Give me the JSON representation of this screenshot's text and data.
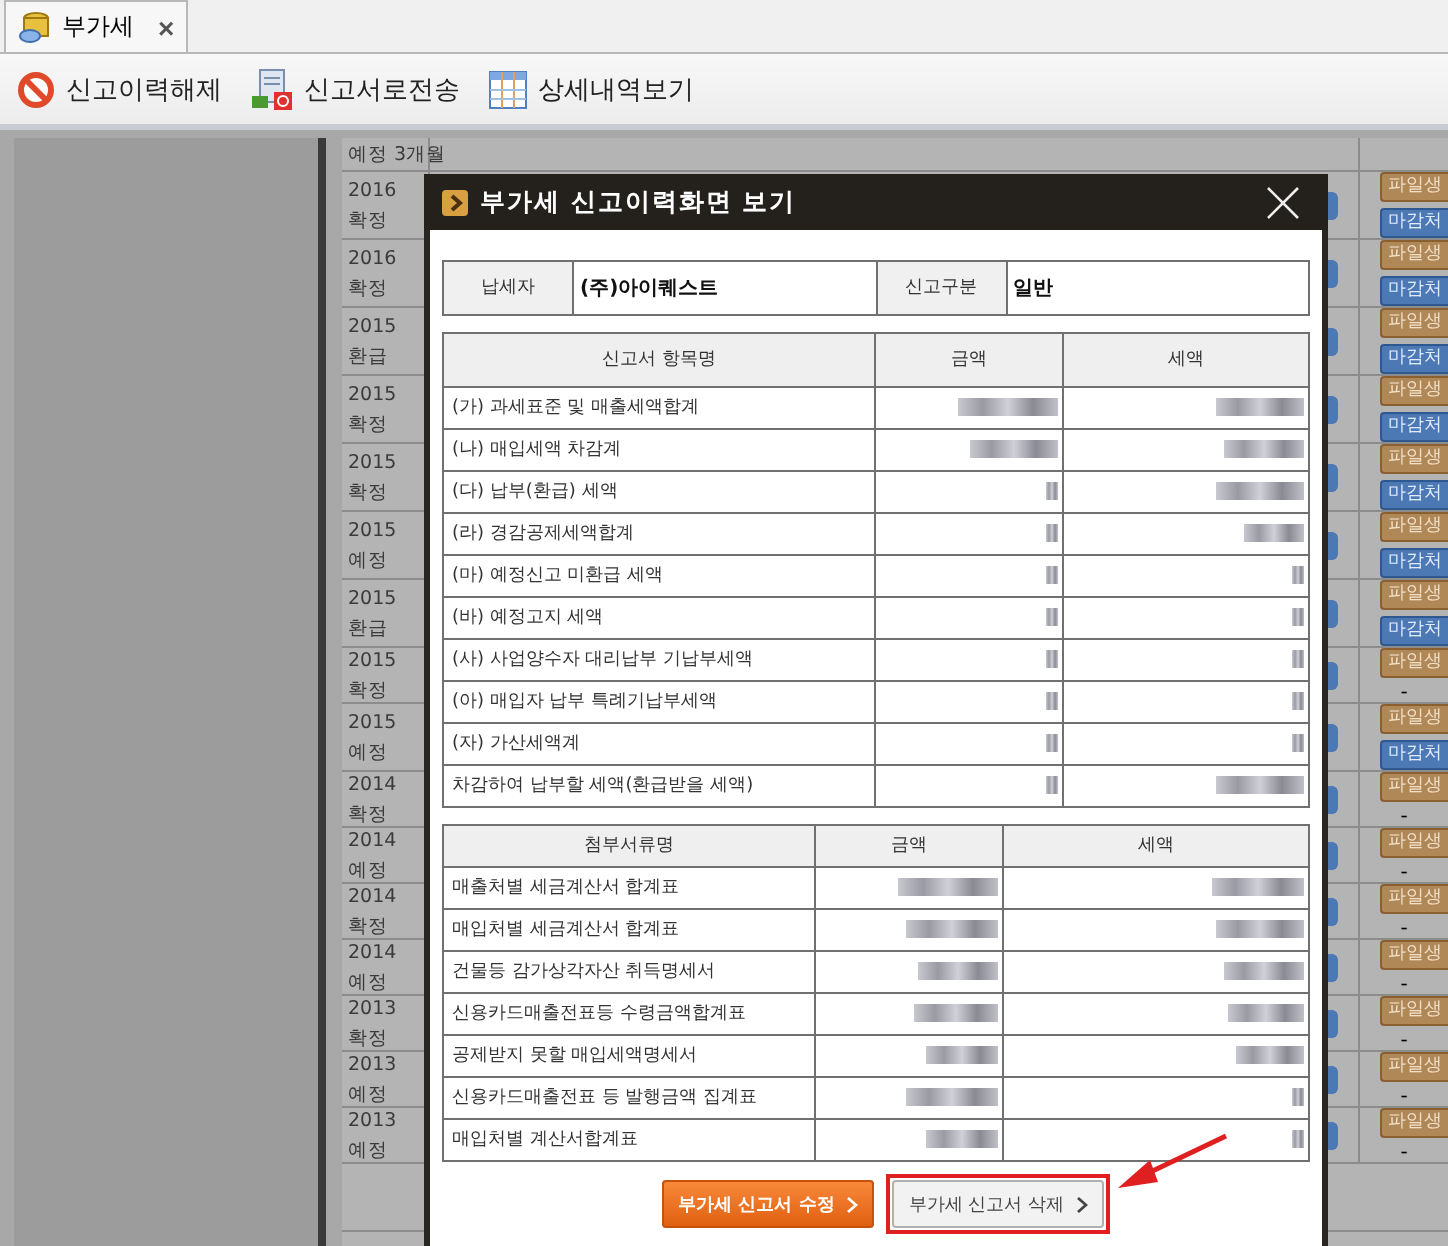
{
  "tab": {
    "label": "부가세",
    "close": "×"
  },
  "toolbar": [
    {
      "kind": "cancel",
      "label": "신고이력해제"
    },
    {
      "kind": "send",
      "label": "신고서로전송"
    },
    {
      "kind": "table",
      "label": "상세내역보기"
    }
  ],
  "grid_rows": [
    {
      "lines": [
        "예정 3개월"
      ],
      "badges": []
    },
    {
      "lines": [
        "2016",
        "확정"
      ],
      "badges": [
        "파일생",
        "마감처"
      ]
    },
    {
      "lines": [
        "2016",
        "확정"
      ],
      "badges": [
        "파일생",
        "마감처"
      ]
    },
    {
      "lines": [
        "2015",
        "환급"
      ],
      "badges": [
        "파일생",
        "마감처"
      ]
    },
    {
      "lines": [
        "2015",
        "확정"
      ],
      "badges": [
        "파일생",
        "마감처"
      ]
    },
    {
      "lines": [
        "2015",
        "확정"
      ],
      "badges": [
        "파일생",
        "마감처"
      ]
    },
    {
      "lines": [
        "2015",
        "예정"
      ],
      "badges": [
        "파일생",
        "마감처"
      ]
    },
    {
      "lines": [
        "2015",
        "환급"
      ],
      "badges": [
        "파일생",
        "마감처"
      ]
    },
    {
      "lines": [
        "2015",
        "확정"
      ],
      "badges": [
        "파일생"
      ],
      "note": "-"
    },
    {
      "lines": [
        "2015",
        "예정"
      ],
      "badges": [
        "파일생",
        "마감처"
      ]
    },
    {
      "lines": [
        "2014",
        "확정"
      ],
      "badges": [
        "파일생"
      ],
      "note": "-"
    },
    {
      "lines": [
        "2014",
        "예정"
      ],
      "badges": [
        "파일생"
      ],
      "note": "-"
    },
    {
      "lines": [
        "2014",
        "확정"
      ],
      "badges": [
        "파일생"
      ],
      "note": "-"
    },
    {
      "lines": [
        "2014",
        "예정"
      ],
      "badges": [
        "파일생"
      ],
      "note": "-"
    },
    {
      "lines": [
        "2013",
        "확정"
      ],
      "badges": [
        "파일생"
      ],
      "note": "-"
    },
    {
      "lines": [
        "2013",
        "예정"
      ],
      "badges": [
        "파일생"
      ],
      "note": "-"
    },
    {
      "lines": [
        "2013",
        "예정"
      ],
      "badges": [
        "파일생"
      ],
      "note": "-"
    }
  ],
  "dialog": {
    "title": "부가세 신고이력화면 보기",
    "info": [
      {
        "label": "납세자",
        "value": "(주)아이퀘스트"
      },
      {
        "label": "신고구분",
        "value": "일반"
      }
    ],
    "report_table": {
      "columns": [
        "신고서 항목명",
        "금액",
        "세액"
      ],
      "rows": [
        {
          "label": "(가) 과세표준 및 매출세액합계"
        },
        {
          "label": "(나) 매입세액 차감계"
        },
        {
          "label": "(다) 납부(환급) 세액"
        },
        {
          "label": "(라) 경감공제세액합계"
        },
        {
          "label": "(마) 예정신고 미환급 세액"
        },
        {
          "label": "(바) 예정고지 세액"
        },
        {
          "label": "(사) 사업양수자 대리납부 기납부세액"
        },
        {
          "label": "(아) 매입자 납부 특례기납부세액"
        },
        {
          "label": "(자) 가산세액계"
        },
        {
          "label": "차감하여 납부할 세액(환급받을 세액)"
        }
      ]
    },
    "attachment_table": {
      "columns": [
        "첨부서류명",
        "금액",
        "세액"
      ],
      "rows": [
        {
          "label": "매출처별 세금계산서 합계표"
        },
        {
          "label": "매입처별 세금계산서 합계표"
        },
        {
          "label": "건물등 감가상각자산 취득명세서"
        },
        {
          "label": "신용카드매출전표등 수령금액합계표"
        },
        {
          "label": "공제받지 못할 매입세액명세서"
        },
        {
          "label": "신용카드매출전표 등 발행금액 집계표"
        },
        {
          "label": "매입처별 계산서합계표"
        }
      ]
    },
    "buttons": [
      {
        "kind": "primary",
        "label": "부가세 신고서 수정",
        "highlighted": false
      },
      {
        "kind": "secondary",
        "label": "부가세 신고서 삭제",
        "highlighted": true
      }
    ]
  }
}
